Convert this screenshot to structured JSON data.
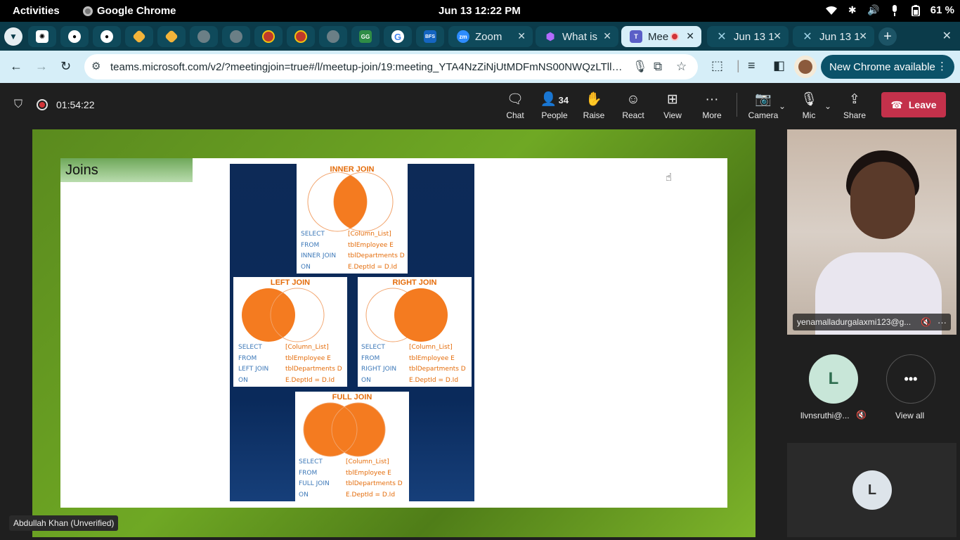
{
  "system_bar": {
    "activities": "Activities",
    "app_name": "Google Chrome",
    "clock": "Jun 13  12:22 PM",
    "battery": "61 %"
  },
  "tabs": [
    {
      "icon": "chatgpt-icon"
    },
    {
      "icon": "github-icon"
    },
    {
      "icon": "github-icon"
    },
    {
      "icon": "vscode-icon"
    },
    {
      "icon": "vscode-icon"
    },
    {
      "icon": "globe-icon"
    },
    {
      "icon": "globe-icon"
    },
    {
      "icon": "badge-icon"
    },
    {
      "icon": "badge-icon"
    },
    {
      "icon": "globe-icon"
    },
    {
      "icon": "gfg-icon"
    },
    {
      "icon": "google-icon"
    },
    {
      "icon": "bfs-icon"
    },
    {
      "label": "Zoom",
      "icon": "zoom-icon"
    },
    {
      "label": "What is",
      "icon": "cube-icon"
    },
    {
      "label": "Mee",
      "icon": "teams-icon",
      "active": true
    },
    {
      "label": "Jun 13 1",
      "icon": "loading-icon"
    },
    {
      "label": "Jun 13 1",
      "icon": "loading-icon"
    }
  ],
  "toolbar": {
    "url": "teams.microsoft.com/v2/?meetingjoin=true#/l/meetup-join/19:meeting_YTA4NzZiNjUtMDFmNS00NWQzLTllOGYtZj...",
    "new_chrome": "New Chrome available"
  },
  "meeting": {
    "timer": "01:54:22",
    "controls": {
      "chat": "Chat",
      "people": "People",
      "people_count": "34",
      "raise": "Raise",
      "react": "React",
      "view": "View",
      "more": "More",
      "camera": "Camera",
      "mic": "Mic",
      "share": "Share",
      "leave": "Leave"
    }
  },
  "slide": {
    "title": "Joins",
    "panels": {
      "inner": {
        "title": "INNER JOIN",
        "kw": [
          "SELECT",
          "FROM",
          "INNER JOIN",
          "ON"
        ],
        "vals": [
          "[Column_List]",
          "tblEmployee E",
          "tblDepartments D",
          "E.DeptId = D.Id"
        ]
      },
      "left": {
        "title": "LEFT JOIN",
        "kw": [
          "SELECT",
          "FROM",
          "LEFT JOIN",
          "ON"
        ],
        "vals": [
          "[Column_List]",
          "tblEmployee E",
          "tblDepartments D",
          "E.DeptId = D.Id"
        ]
      },
      "right": {
        "title": "RIGHT JOIN",
        "kw": [
          "SELECT",
          "FROM",
          "RIGHT JOIN",
          "ON"
        ],
        "vals": [
          "[Column_List]",
          "tblEmployee E",
          "tblDepartments D",
          "E.DeptId = D.Id"
        ]
      },
      "full": {
        "title": "FULL JOIN",
        "kw": [
          "SELECT",
          "FROM",
          "FULL JOIN",
          "ON"
        ],
        "vals": [
          "[Column_List]",
          "tblEmployee E",
          "tblDepartments D",
          "E.DeptId = D.Id"
        ]
      }
    },
    "presenter": "Abdullah Khan (Unverified)"
  },
  "participants": {
    "main_name": "yenamalladurgalaxmi123@g...",
    "second_initial": "L",
    "second_name": "llvnsruthi@...",
    "view_all": "View all",
    "third_initial": "L"
  },
  "colors": {
    "accent_orange": "#e46c0a",
    "leave_red": "#c4314b",
    "slide_green": "#6fa824",
    "diagram_navy": "#0d2a57"
  }
}
